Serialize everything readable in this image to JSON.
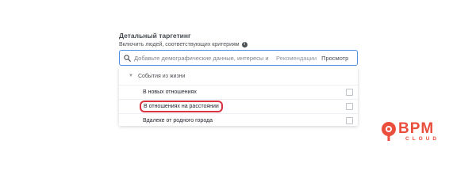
{
  "targeting": {
    "title": "Детальный таргетинг",
    "subtitle": "Включить людей, соответствующих критериям",
    "info_icon": "info-icon"
  },
  "search": {
    "icon": "search-icon",
    "placeholder": "Добавьте демографические данные, интересы и",
    "value": "",
    "recommendations_label": "Рекомендации",
    "browse_label": "Просмотр"
  },
  "dropdown": {
    "category": {
      "icon": "caret-down-icon",
      "label": "События из жизни"
    },
    "items": [
      {
        "label": "В новых отношениях",
        "checked": false
      },
      {
        "label": "В отношениях на расстоянии",
        "checked": false,
        "highlighted": true
      },
      {
        "label": "Вдалеке от родного города",
        "checked": false
      }
    ]
  },
  "brand": {
    "name": "BPM",
    "sub": "CLOUD"
  },
  "colors": {
    "accent_border": "#4a90e2",
    "highlight": "#d9343f",
    "brand": "#ea4e3d",
    "text": "#4b4f56"
  }
}
